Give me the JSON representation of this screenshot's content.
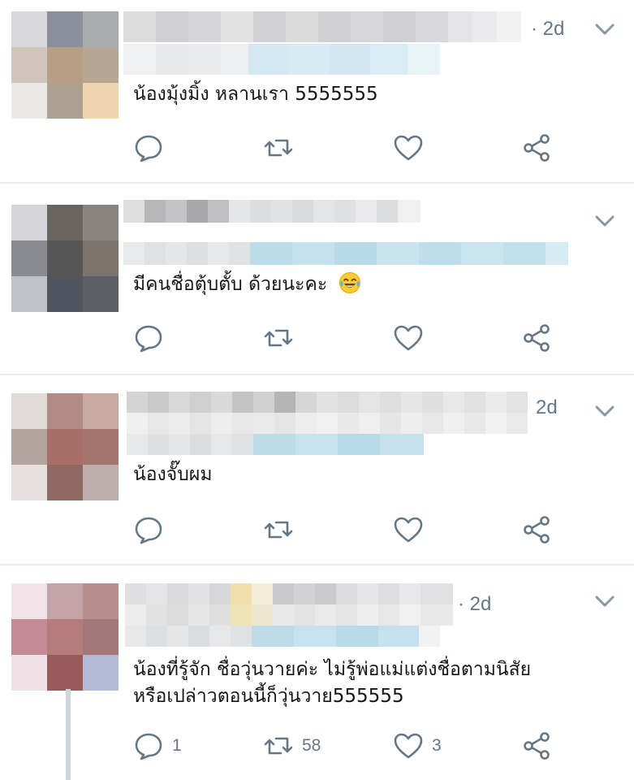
{
  "tweets": [
    {
      "time": "· 2d",
      "text": "น้องมุ้งมิ้ง หลานเรา 5555555",
      "reply_count": "",
      "retweet_count": "",
      "like_count": ""
    },
    {
      "time": "",
      "text": "มีคนชื่อตุ้บตั้บ ด้วยนะคะ",
      "emoji": "face-with-tears-of-joy-icon",
      "reply_count": "",
      "retweet_count": "",
      "like_count": ""
    },
    {
      "time": "2d",
      "text": "น้องจั๊บผม",
      "reply_count": "",
      "retweet_count": "",
      "like_count": ""
    },
    {
      "time": "· 2d",
      "text_line1": "น้องที่รู้จัก ชื่อวุ่นวายค่ะ ไม่รู้พ่อแม่แต่งชื่อตามนิสัย",
      "text_line2": "หรือเปล่าวตอนนี้ก็วุ่นวาย555555",
      "reply_count": "1",
      "retweet_count": "58",
      "like_count": "3"
    }
  ],
  "icons": [
    "reply-icon",
    "retweet-icon",
    "like-icon",
    "share-icon",
    "chevron-down-icon"
  ],
  "colors": {
    "icon": "#657786",
    "divider": "#e6ecf0",
    "link_blur": "#bcdcea"
  }
}
